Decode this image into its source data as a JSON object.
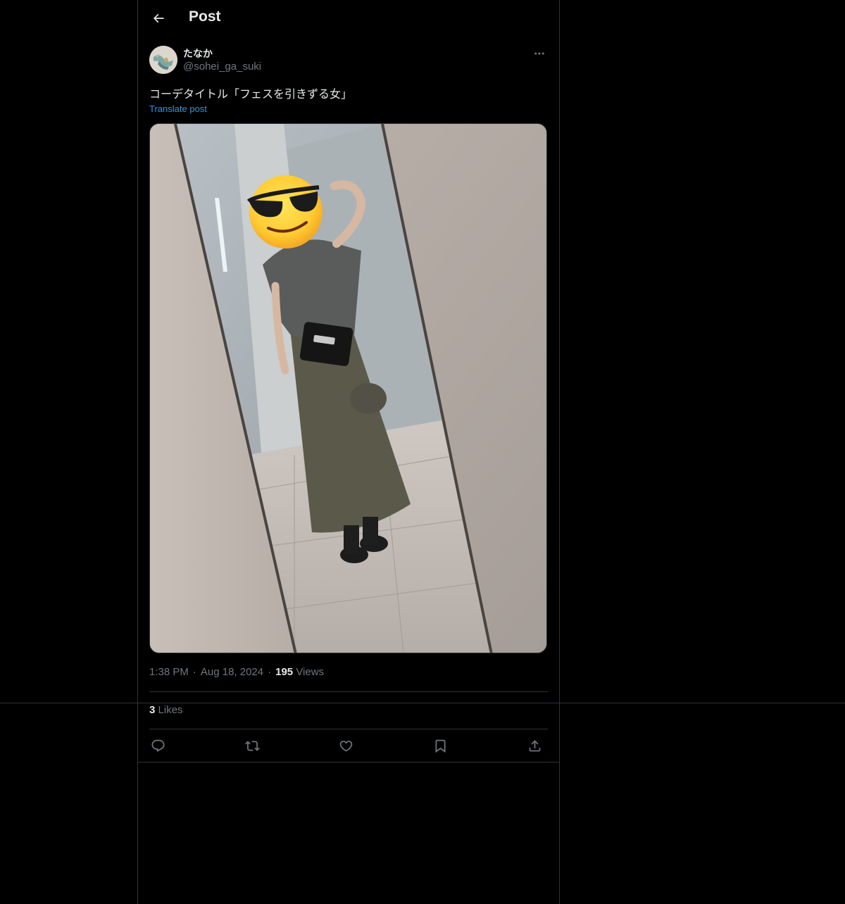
{
  "header": {
    "title": "Post",
    "back_icon": "arrow-left-icon"
  },
  "post": {
    "author": {
      "display_name": "たなか",
      "handle": "@sohei_ga_suki",
      "avatar_icon": "bird-avatar"
    },
    "text": "コーデタイトル「フェスを引きずる女」",
    "translate_label": "Translate post",
    "media": {
      "type": "photo",
      "subject": "mirror-selfie"
    },
    "meta": {
      "time": "1:38 PM",
      "date": "Aug 18, 2024",
      "views_count": "195",
      "views_label": "Views"
    },
    "stats": {
      "likes_count": "3",
      "likes_label": "Likes"
    },
    "actions": [
      {
        "name": "reply",
        "icon": "reply-icon"
      },
      {
        "name": "repost",
        "icon": "repost-icon"
      },
      {
        "name": "like",
        "icon": "heart-icon"
      },
      {
        "name": "bookmark",
        "icon": "bookmark-icon"
      },
      {
        "name": "share",
        "icon": "share-icon"
      }
    ]
  },
  "colors": {
    "background": "#000000",
    "text": "#e7e9ea",
    "secondary_text": "#71767b",
    "link": "#1d9bf0",
    "border": "#2f3336"
  }
}
